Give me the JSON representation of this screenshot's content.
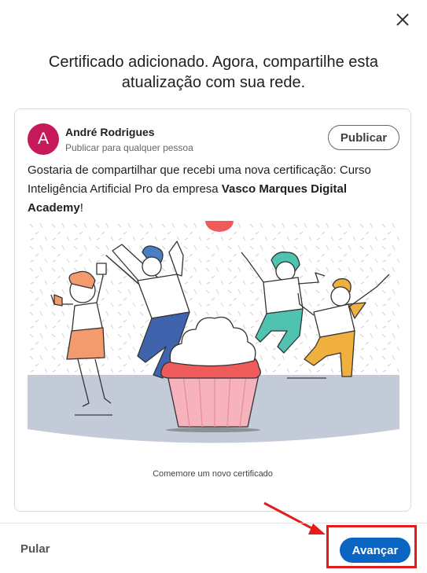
{
  "dialog": {
    "title": "Certificado adicionado. Agora, compartilhe esta atualização com sua rede."
  },
  "post": {
    "avatar_letter": "A",
    "author_name": "André Rodrigues",
    "visibility": "Publicar para qualquer pessoa",
    "publish_label": "Publicar",
    "text_prefix": "Gostaria de compartilhar que recebi uma nova certificação: Curso Inteligência Artificial Pro da empresa ",
    "company": "Vasco Marques Digital Academy",
    "text_suffix": "!",
    "image_caption": "Comemore um novo certificado"
  },
  "footer": {
    "skip_label": "Pular",
    "next_label": "Avançar"
  },
  "colors": {
    "avatar": "#c6195a",
    "primary": "#0a66c2",
    "highlight": "#e31d1d"
  }
}
